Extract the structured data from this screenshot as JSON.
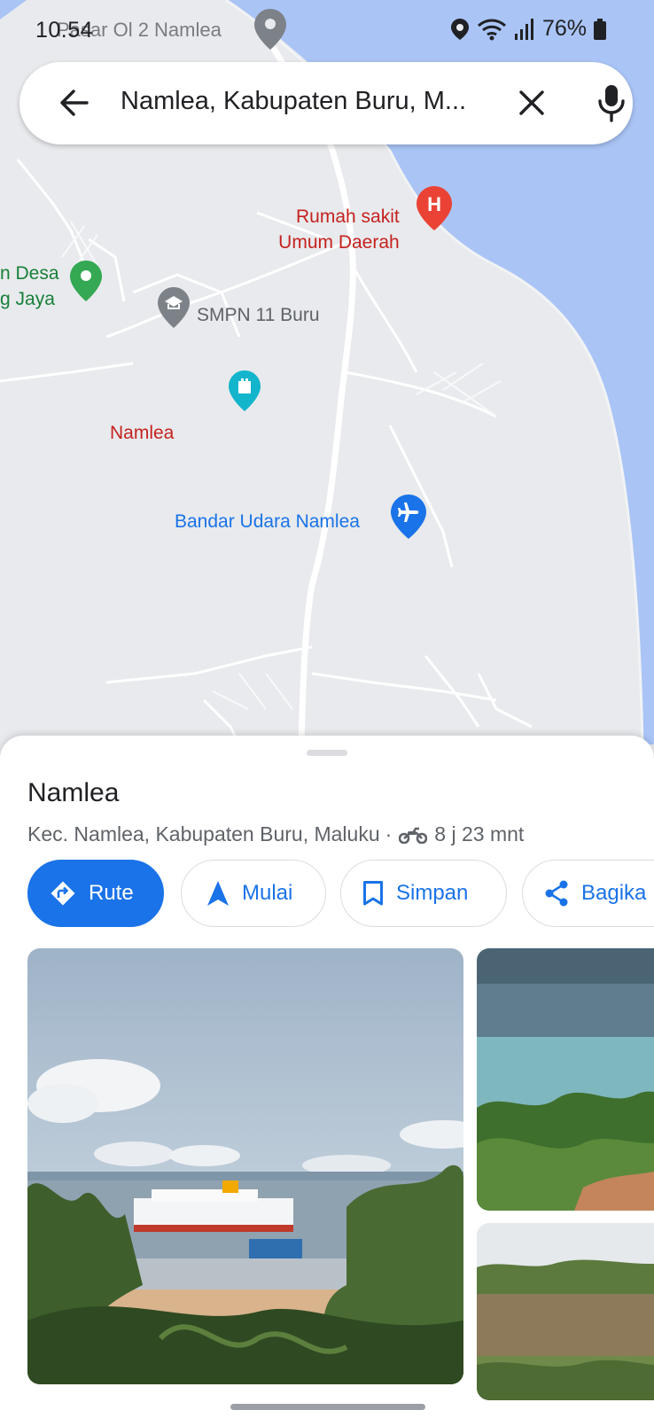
{
  "status_bar": {
    "time": "10.54",
    "ghost_text": "Pasar Ol 2  Namlea",
    "battery": "76%"
  },
  "search": {
    "query": "Namlea, Kabupaten Buru, M..."
  },
  "map": {
    "labels": {
      "hospital": [
        "Rumah sakit",
        "Umum Daerah"
      ],
      "village": [
        "n Desa",
        "g Jaya"
      ],
      "school": "SMPN 11 Buru",
      "town": "Namlea",
      "airport": "Bandar Udara Namlea"
    },
    "colors": {
      "land": "#e8eaed",
      "water": "#aac4f6",
      "road": "#ffffff",
      "hospital": "#ea4335",
      "park": "#34a853",
      "school": "#5f6368",
      "attraction": "#12b5cb",
      "airport": "#1a73e8",
      "town": "#c5221f"
    }
  },
  "place": {
    "title": "Namlea",
    "subtitle": "Kec. Namlea, Kabupaten Buru, Maluku",
    "travel_time": "8 j 23 mnt"
  },
  "actions": {
    "route": "Rute",
    "start": "Mulai",
    "save": "Simpan",
    "share": "Bagika"
  },
  "icons": {
    "back": "arrow-left-icon",
    "clear": "close-icon",
    "mic": "microphone-icon",
    "route": "directions-icon",
    "start": "navigation-arrow-icon",
    "save": "bookmark-icon",
    "share": "share-icon",
    "travel_mode": "motorcycle-icon"
  },
  "accent": "#1a73e8"
}
